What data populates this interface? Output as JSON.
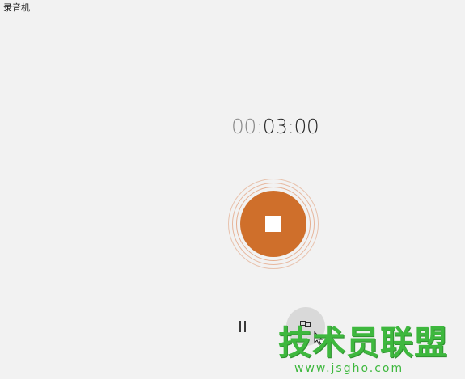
{
  "app": {
    "title": "录音机"
  },
  "timer": {
    "dim_part": "00:",
    "main_part": "03:00"
  },
  "controls": {
    "record_stop_icon": "stop-icon",
    "pause_icon": "pause-icon",
    "marker_icon": "flag-icon"
  },
  "watermark": {
    "main_text": "技术员联盟",
    "url_text": "www.jsgho.com"
  },
  "colors": {
    "background": "#f2f2f2",
    "record_accent": "#cf6f2b",
    "watermark_green": "#3eb83e"
  }
}
